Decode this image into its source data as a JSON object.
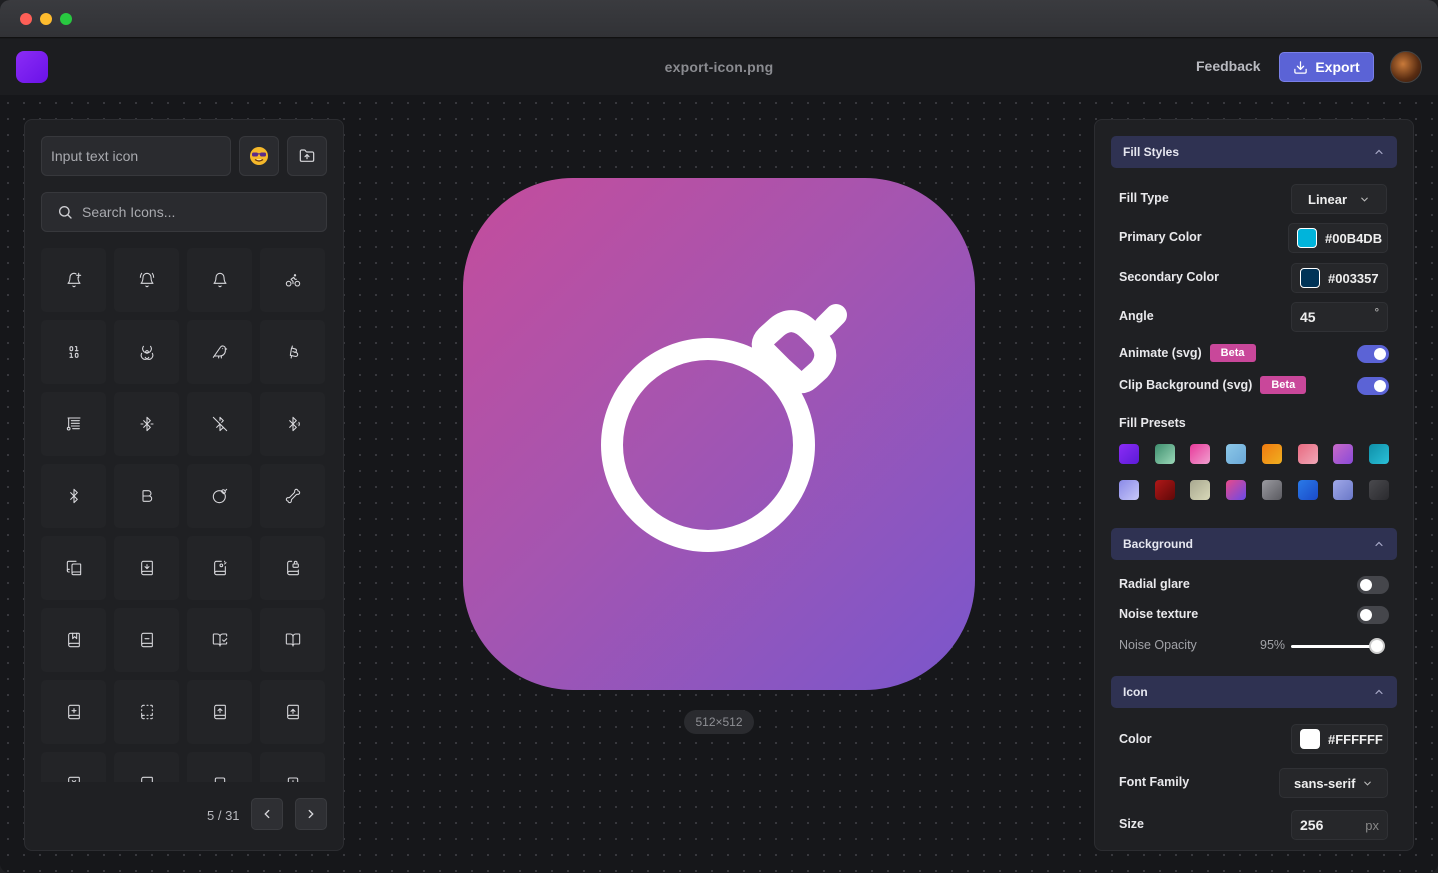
{
  "window": {
    "filename": "export-icon.png"
  },
  "header": {
    "feedback_label": "Feedback",
    "export_label": "Export"
  },
  "left": {
    "text_input_placeholder": "Input text icon",
    "search_placeholder": "Search Icons...",
    "pager": "5 / 31",
    "icons": [
      "bell-plus-icon",
      "bell-ringing-icon",
      "bell-icon",
      "bike-icon",
      "binary-icon",
      "biohazard-icon",
      "bird-icon",
      "bitcoin-icon",
      "blinds-icon",
      "bluetooth-connected-icon",
      "bluetooth-off-icon",
      "bluetooth-searching-icon",
      "bluetooth-icon",
      "bold-icon",
      "bomb-icon",
      "bone-icon",
      "book-copy-icon",
      "book-down-icon",
      "book-key-icon",
      "book-lock-icon",
      "book-marked-icon",
      "book-minus-icon",
      "book-open-check-icon",
      "book-open-icon",
      "book-plus-icon",
      "book-dashed-icon",
      "book-up-icon",
      "book-up-2-icon",
      "book-x-icon",
      "book-icon",
      "bookmark-minus-icon",
      "bookmark-plus-icon"
    ]
  },
  "preview": {
    "size_label": "512×512",
    "bg_from": "#C44D9C",
    "bg_to": "#7A56CC",
    "icon_color": "#FFFFFF",
    "icon_name": "bomb-icon"
  },
  "right": {
    "fill_styles": {
      "title": "Fill Styles",
      "fill_type_label": "Fill Type",
      "fill_type_value": "Linear",
      "primary_label": "Primary Color",
      "primary_value": "#00B4DB",
      "secondary_label": "Secondary Color",
      "secondary_value": "#003357",
      "angle_label": "Angle",
      "angle_value": "45",
      "angle_unit": "°",
      "animate_label": "Animate (svg)",
      "clip_label": "Clip Background (svg)",
      "beta": "Beta",
      "presets_label": "Fill Presets",
      "presets": [
        "#8B2CF5",
        "#3E8E6E",
        "#E8399A",
        "#8CC8E8",
        "#F07A10",
        "#E86A80",
        "#C86AC8",
        "#0F8FA8",
        "#8A8AE8",
        "#B01818",
        "#A8A890",
        "#E84A8A",
        "#9A9AA0",
        "#2A7AE8",
        "#A0A8E8",
        "#4A4A4E"
      ]
    },
    "background": {
      "title": "Background",
      "radial_label": "Radial glare",
      "noise_label": "Noise texture",
      "noise_opacity_label": "Noise Opacity",
      "noise_opacity_value": "95%",
      "noise_opacity": 0.95
    },
    "icon": {
      "title": "Icon",
      "color_label": "Color",
      "color_value": "#FFFFFF",
      "font_label": "Font Family",
      "font_value": "sans-serif",
      "size_label": "Size",
      "size_value": "256",
      "size_unit": "px"
    }
  }
}
